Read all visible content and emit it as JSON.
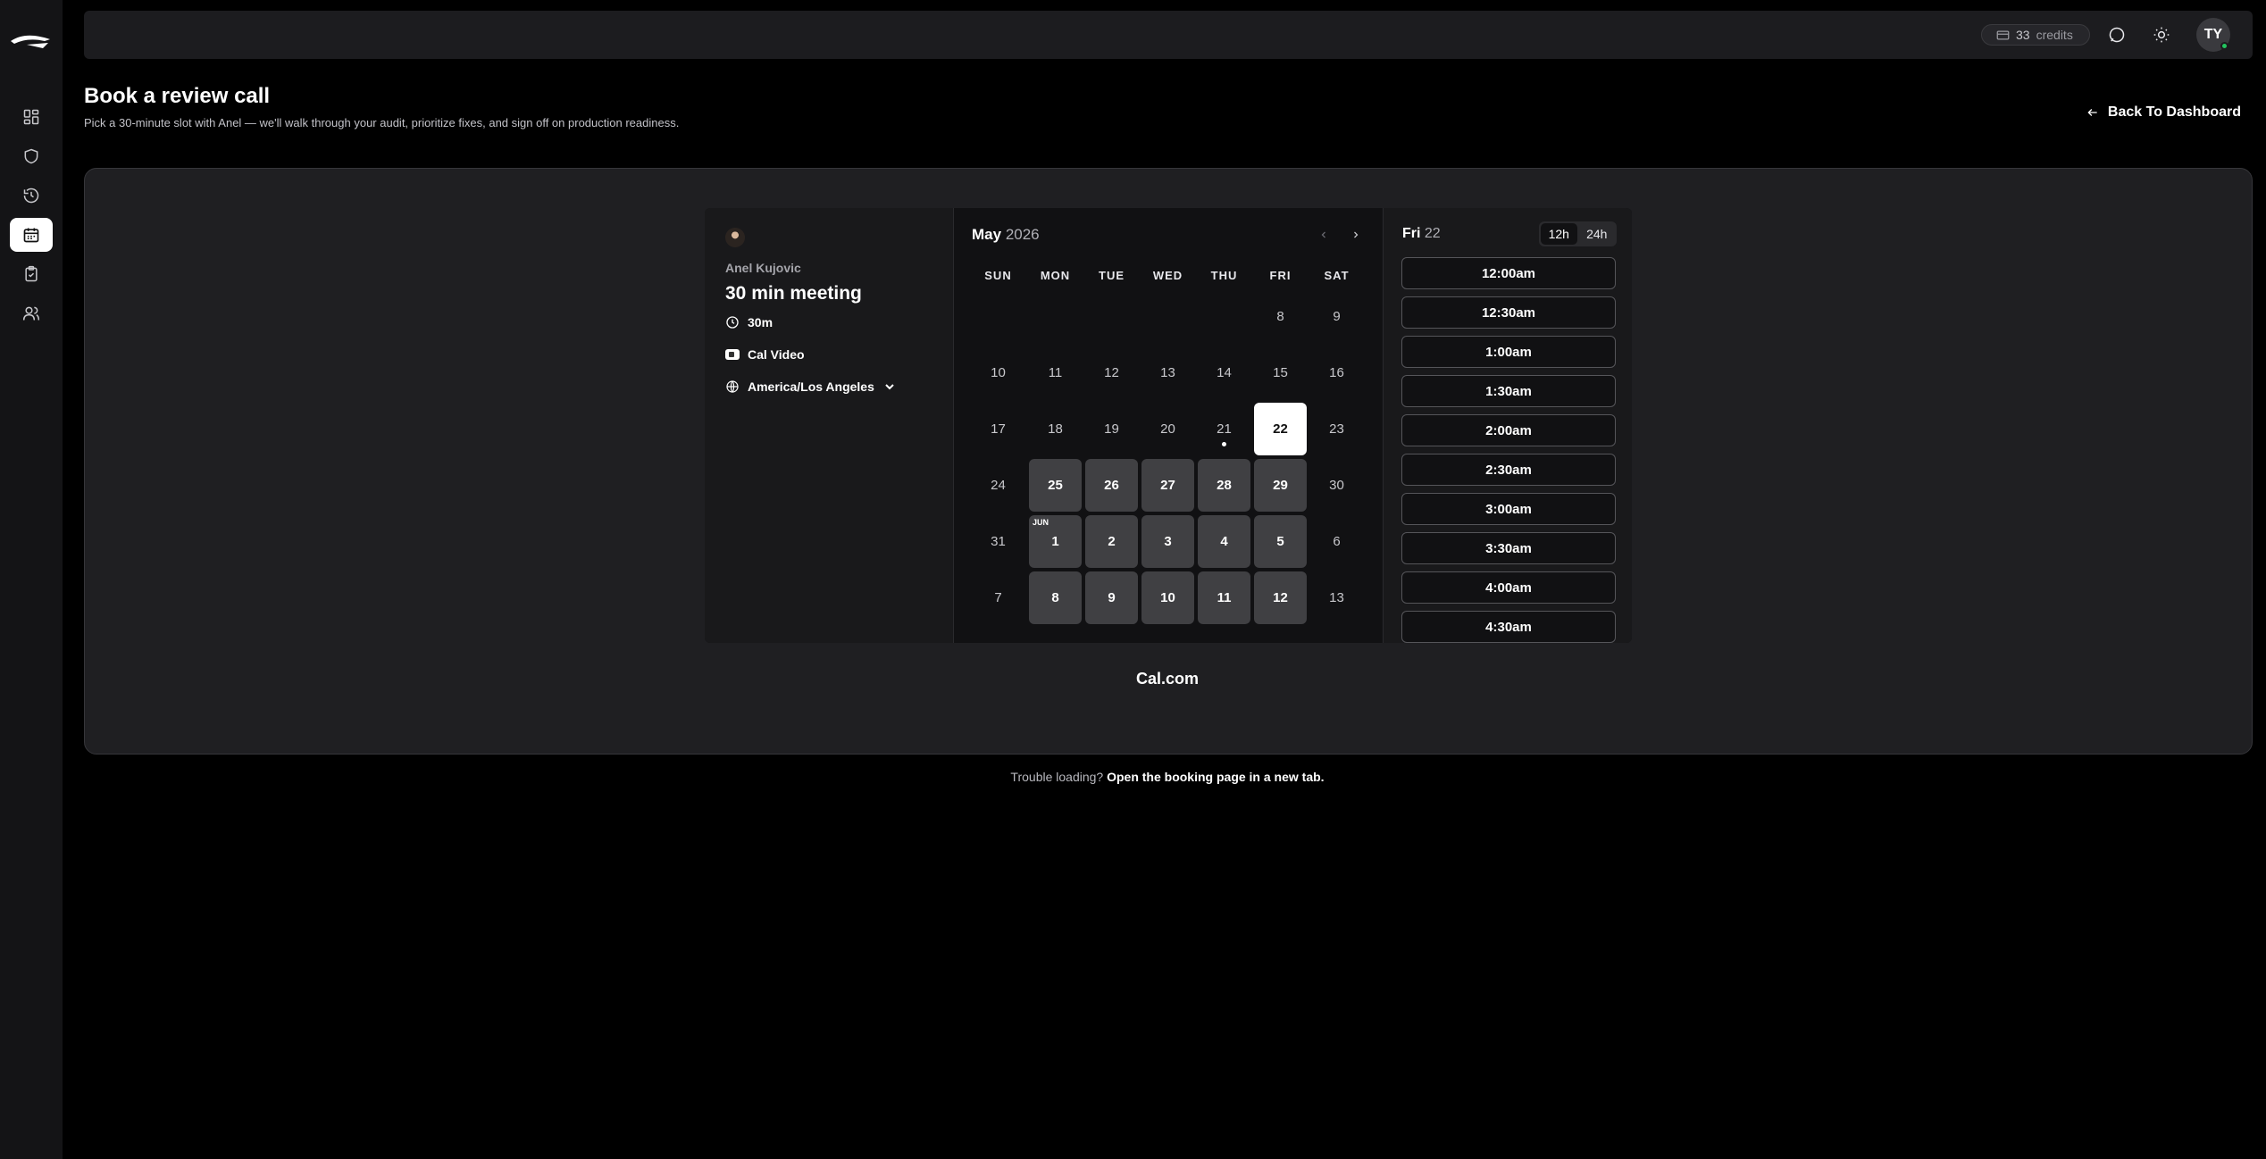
{
  "sidebar": {
    "items": [
      {
        "icon": "dashboard-icon"
      },
      {
        "icon": "shield-icon"
      },
      {
        "icon": "history-icon"
      },
      {
        "icon": "calendar-icon",
        "active": true
      },
      {
        "icon": "clipboard-check-icon"
      },
      {
        "icon": "users-icon"
      }
    ]
  },
  "topbar": {
    "credits_count": "33",
    "credits_label": "credits",
    "avatar_initials": "TY"
  },
  "header": {
    "title": "Book a review call",
    "subtitle": "Pick a 30-minute slot with Anel — we'll walk through your audit, prioritize fixes, and sign off on production readiness.",
    "back_label": "Back To Dashboard"
  },
  "booker": {
    "host_name": "Anel Kujovic",
    "event_title": "30 min meeting",
    "duration": "30m",
    "location": "Cal Video",
    "timezone": "America/Los Angeles",
    "month": "May",
    "year": "2026",
    "weekdays": [
      "SUN",
      "MON",
      "TUE",
      "WED",
      "THU",
      "FRI",
      "SAT"
    ],
    "days": [
      {
        "label": "8",
        "state": "disabled"
      },
      {
        "label": "9",
        "state": "disabled"
      },
      {
        "label": "10",
        "state": "disabled"
      },
      {
        "label": "11",
        "state": "disabled"
      },
      {
        "label": "12",
        "state": "disabled"
      },
      {
        "label": "13",
        "state": "disabled"
      },
      {
        "label": "14",
        "state": "disabled"
      },
      {
        "label": "15",
        "state": "disabled"
      },
      {
        "label": "16",
        "state": "disabled"
      },
      {
        "label": "17",
        "state": "disabled"
      },
      {
        "label": "18",
        "state": "disabled"
      },
      {
        "label": "19",
        "state": "disabled"
      },
      {
        "label": "20",
        "state": "disabled"
      },
      {
        "label": "21",
        "state": "today"
      },
      {
        "label": "22",
        "state": "selected"
      },
      {
        "label": "23",
        "state": "disabled"
      },
      {
        "label": "24",
        "state": "disabled"
      },
      {
        "label": "25",
        "state": "available"
      },
      {
        "label": "26",
        "state": "available"
      },
      {
        "label": "27",
        "state": "available"
      },
      {
        "label": "28",
        "state": "available"
      },
      {
        "label": "29",
        "state": "available"
      },
      {
        "label": "30",
        "state": "disabled"
      },
      {
        "label": "31",
        "state": "disabled"
      },
      {
        "label": "1",
        "state": "available",
        "month_tag": "JUN"
      },
      {
        "label": "2",
        "state": "available"
      },
      {
        "label": "3",
        "state": "available"
      },
      {
        "label": "4",
        "state": "available"
      },
      {
        "label": "5",
        "state": "available"
      },
      {
        "label": "6",
        "state": "disabled"
      },
      {
        "label": "7",
        "state": "disabled"
      },
      {
        "label": "8",
        "state": "available"
      },
      {
        "label": "9",
        "state": "available"
      },
      {
        "label": "10",
        "state": "available"
      },
      {
        "label": "11",
        "state": "available"
      },
      {
        "label": "12",
        "state": "available"
      },
      {
        "label": "13",
        "state": "disabled"
      }
    ],
    "selected_day_name": "Fri",
    "selected_day_num": "22",
    "time_formats": [
      "12h",
      "24h"
    ],
    "active_time_format": "12h",
    "slots": [
      "12:00am",
      "12:30am",
      "1:00am",
      "1:30am",
      "2:00am",
      "2:30am",
      "3:00am",
      "3:30am",
      "4:00am",
      "4:30am"
    ],
    "powered_by": "Cal.com"
  },
  "footer": {
    "prefix": "Trouble loading?",
    "link": "Open the booking page in a new tab."
  }
}
